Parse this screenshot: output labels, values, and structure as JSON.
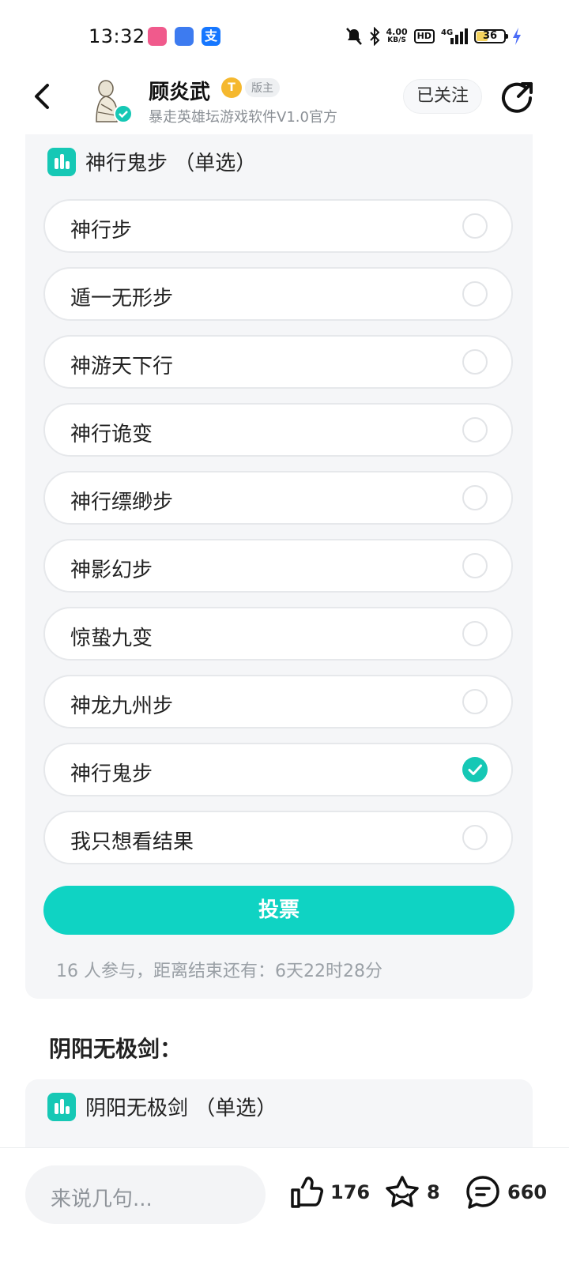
{
  "status_bar": {
    "time": "13:32",
    "net_speed": "4.00",
    "net_unit": "KB/S",
    "hd_label": "HD",
    "signal_label": "4G",
    "battery": "36",
    "app_icons": [
      {
        "name": "bilibili-icon",
        "color": "#f05a8c"
      },
      {
        "name": "yuer-icon",
        "color": "#3d7bf0"
      },
      {
        "name": "alipay-icon",
        "color": "#1677ff"
      }
    ]
  },
  "header": {
    "user_name": "顾炎武",
    "level_badge": "T",
    "role_badge": "版主",
    "subtitle": "暴走英雄坛游戏软件V1.0官方",
    "follow_label": "已关注"
  },
  "poll": {
    "title": "神行鬼步 （单选）",
    "options": [
      {
        "label": "神行步",
        "checked": false
      },
      {
        "label": "遁一无形步",
        "checked": false
      },
      {
        "label": "神游天下行",
        "checked": false
      },
      {
        "label": "神行诡变",
        "checked": false
      },
      {
        "label": "神行缥缈步",
        "checked": false
      },
      {
        "label": "神影幻步",
        "checked": false
      },
      {
        "label": "惊蛰九变",
        "checked": false
      },
      {
        "label": "神龙九州步",
        "checked": false
      },
      {
        "label": "神行鬼步",
        "checked": true
      },
      {
        "label": "我只想看结果",
        "checked": false
      }
    ],
    "vote_label": "投票",
    "footer": "16 人参与，距离结束还有：6天22时28分"
  },
  "section2": {
    "title": "阴阳无极剑：",
    "poll_title": "阴阳无极剑 （单选）"
  },
  "bottom_bar": {
    "comment_placeholder": "来说几句...",
    "likes": "176",
    "favorites": "8",
    "comments": "660"
  },
  "colors": {
    "accent": "#0fd3c3",
    "card_bg": "#f5f6f8"
  }
}
